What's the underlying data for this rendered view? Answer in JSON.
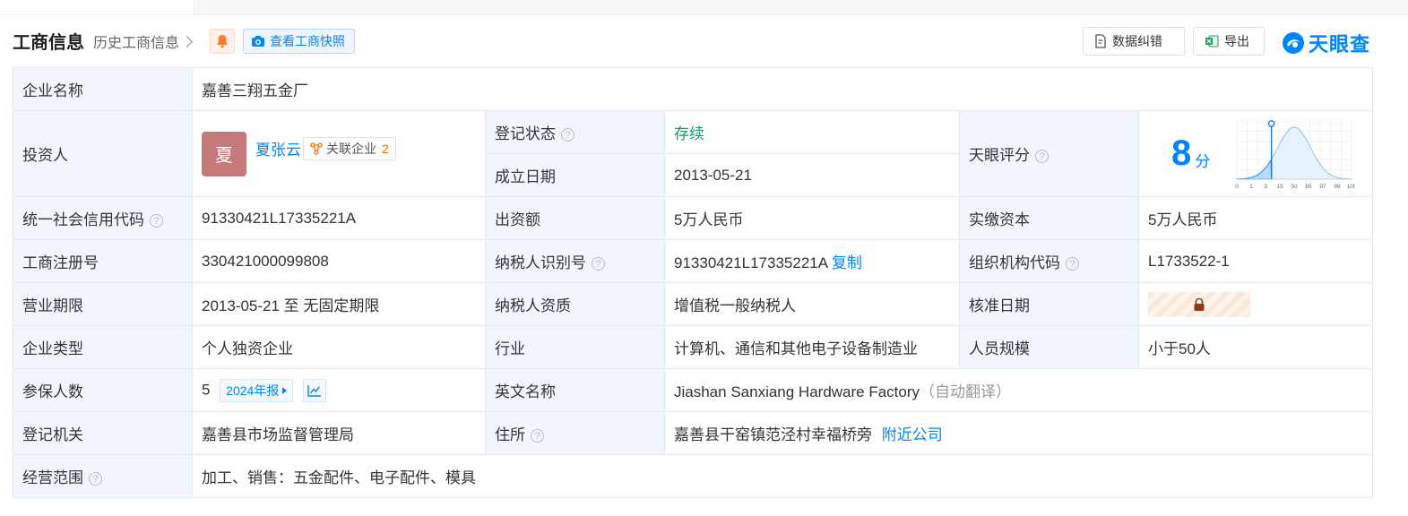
{
  "header": {
    "title": "工商信息",
    "history_link": "历史工商信息",
    "snapshot_button": "查看工商快照",
    "data_fix_button": "数据纠错",
    "export_button": "导出",
    "brand": "天眼查"
  },
  "colors": {
    "accent": "#0084ff",
    "label_bg": "#f1f6fe",
    "status_green": "#12a15c",
    "count_orange": "#ff6a00",
    "avatar": "#c67a7a"
  },
  "fields": {
    "company_name": {
      "label": "企业名称",
      "value": "嘉善三翔五金厂"
    },
    "investor": {
      "label": "投资人",
      "avatar_char": "夏",
      "name": "夏张云",
      "related_label": "关联企业",
      "related_count": "2"
    },
    "reg_status": {
      "label": "登记状态",
      "value": "存续"
    },
    "founded": {
      "label": "成立日期",
      "value": "2013-05-21"
    },
    "tianyan_score": {
      "label": "天眼评分",
      "value": "8",
      "unit": "分"
    },
    "credit_code": {
      "label": "统一社会信用代码",
      "value": "91330421L17335221A"
    },
    "contribution": {
      "label": "出资额",
      "value": "5万人民币"
    },
    "paid_capital": {
      "label": "实缴资本",
      "value": "5万人民币"
    },
    "reg_number": {
      "label": "工商注册号",
      "value": "330421000099808"
    },
    "taxpayer_id": {
      "label": "纳税人识别号",
      "value": "91330421L17335221A",
      "copy": "复制"
    },
    "org_code": {
      "label": "组织机构代码",
      "value": "L1733522-1"
    },
    "business_term": {
      "label": "营业期限",
      "value": "2013-05-21 至 无固定期限"
    },
    "taxpayer_qual": {
      "label": "纳税人资质",
      "value": "增值税一般纳税人"
    },
    "approval_date": {
      "label": "核准日期"
    },
    "company_type": {
      "label": "企业类型",
      "value": "个人独资企业"
    },
    "industry": {
      "label": "行业",
      "value": "计算机、通信和其他电子设备制造业"
    },
    "staff_size": {
      "label": "人员规模",
      "value": "小于50人"
    },
    "insured": {
      "label": "参保人数",
      "value": "5",
      "report": "2024年报"
    },
    "english_name": {
      "label": "英文名称",
      "value": "Jiashan Sanxiang Hardware Factory",
      "note": "（自动翻译）"
    },
    "reg_authority": {
      "label": "登记机关",
      "value": "嘉善县市场监督管理局"
    },
    "address": {
      "label": "住所",
      "value": "嘉善县干窑镇范泾村幸福桥旁",
      "nearby": "附近公司"
    },
    "business_scope": {
      "label": "经营范围",
      "value": "加工、销售：五金配件、电子配件、模具"
    }
  },
  "chart_data": {
    "type": "area",
    "x": [
      0,
      1,
      3,
      15,
      50,
      85,
      97,
      99,
      100
    ],
    "tick_labels": [
      "0",
      "1",
      "3",
      "15",
      "50",
      "85",
      "97",
      "99",
      "100"
    ],
    "marker_value": 8,
    "grid": true
  }
}
